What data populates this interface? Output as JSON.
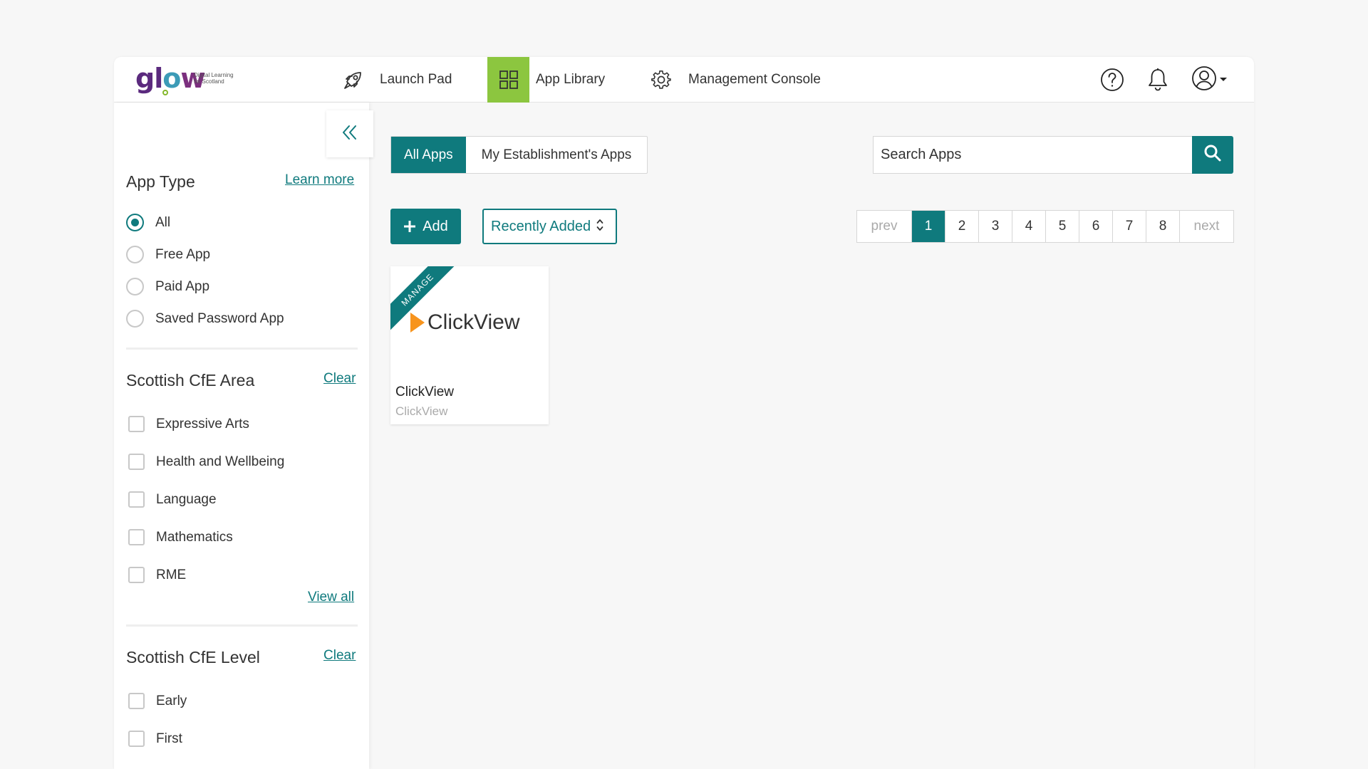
{
  "logo": {
    "brand": "glow",
    "tagline_line1": "Digital Learning",
    "tagline_line2": "for Scotland"
  },
  "nav": {
    "launch_pad": "Launch Pad",
    "app_library": "App Library",
    "management_console": "Management Console"
  },
  "sidebar": {
    "app_type": {
      "title": "App Type",
      "link": "Learn more",
      "options": [
        "All",
        "Free App",
        "Paid App",
        "Saved Password App"
      ],
      "selected": "All"
    },
    "cfe_area": {
      "title": "Scottish CfE Area",
      "link": "Clear",
      "options": [
        "Expressive Arts",
        "Health and Wellbeing",
        "Language",
        "Mathematics",
        "RME"
      ],
      "view_all": "View all"
    },
    "cfe_level": {
      "title": "Scottish CfE Level",
      "link": "Clear",
      "options": [
        "Early",
        "First"
      ]
    }
  },
  "main": {
    "tabs": [
      "All Apps",
      "My Establishment's Apps"
    ],
    "active_tab": "All Apps",
    "search_placeholder": "Search Apps",
    "add_label": "Add",
    "sort_label": "Recently Added",
    "pager": {
      "prev": "prev",
      "pages": [
        "1",
        "2",
        "3",
        "4",
        "5",
        "6",
        "7",
        "8"
      ],
      "current": "1",
      "next": "next"
    },
    "apps": [
      {
        "ribbon": "MANAGE",
        "logo_text": "ClickView",
        "title": "ClickView",
        "subtitle": "ClickView"
      }
    ]
  },
  "colors": {
    "accent": "#0f7a7d",
    "library_tile": "#8cc63f",
    "clickview_orange": "#f7941d"
  },
  "icons": [
    "rocket-icon",
    "grid-icon",
    "gear-icon",
    "help-icon",
    "bell-icon",
    "user-icon",
    "chevron-double-left-icon",
    "search-icon",
    "plus-icon",
    "sort-arrows-icon"
  ]
}
